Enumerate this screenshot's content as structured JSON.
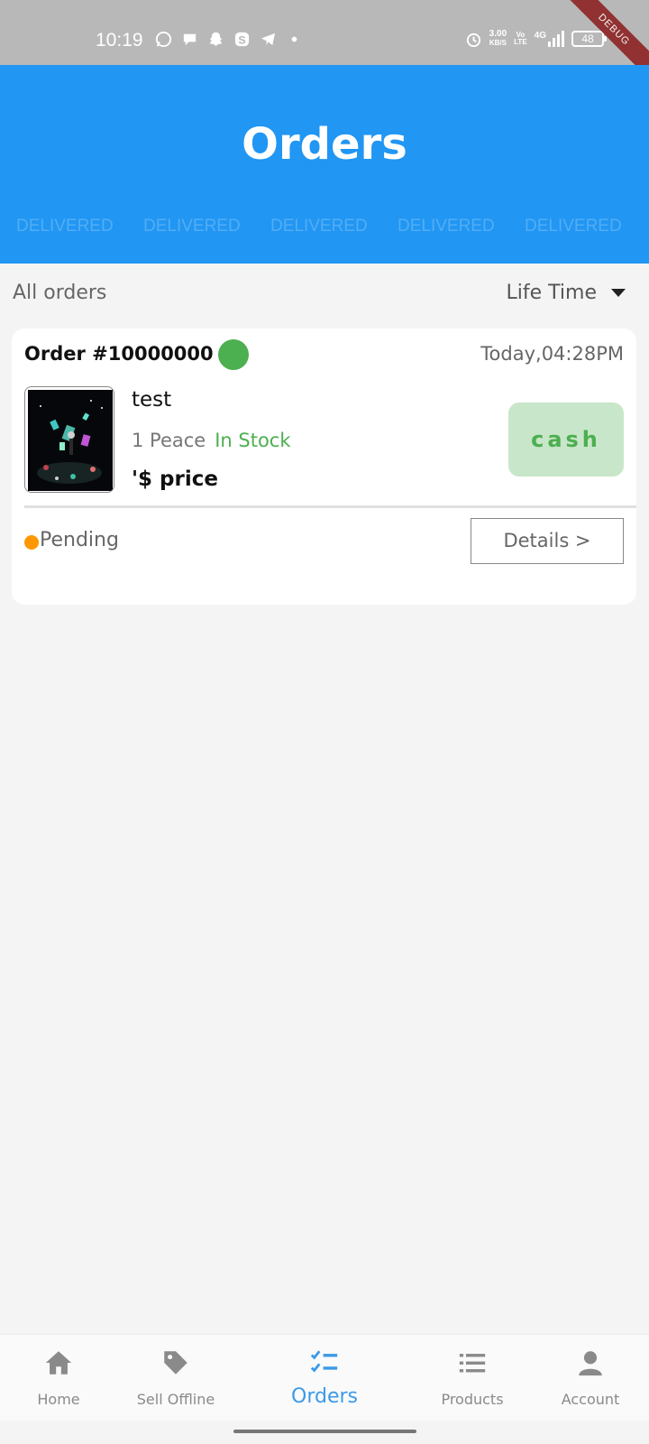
{
  "status_bar": {
    "time": "10:19",
    "speed_value": "3.00",
    "speed_unit": "KB/S",
    "volte_top": "Vo",
    "volte_bottom": "LTE",
    "network": "4G",
    "battery": "48",
    "debug_label": "DEBUG"
  },
  "header": {
    "title": "Orders",
    "tabs": [
      "DELIVERED",
      "DELIVERED",
      "DELIVERED",
      "DELIVERED",
      "DELIVERED"
    ]
  },
  "filter": {
    "all_orders_label": "All orders",
    "period_label": "Life Time"
  },
  "order": {
    "title": "Order #10000000",
    "date": "Today,04:28PM",
    "product_name": "test",
    "quantity": "1 Peace",
    "stock_status": "In Stock",
    "price": "'$ price",
    "payment_method": "cash",
    "status": "Pending",
    "details_label": "Details >"
  },
  "bottom_nav": {
    "items": [
      {
        "label": "Home",
        "icon": "home-icon"
      },
      {
        "label": "Sell Offline",
        "icon": "tag-icon"
      },
      {
        "label": "Orders",
        "icon": "checklist-icon"
      },
      {
        "label": "Products",
        "icon": "list-icon"
      },
      {
        "label": "Account",
        "icon": "person-icon"
      }
    ],
    "active": "Orders"
  },
  "colors": {
    "primary": "#2196f3",
    "in_stock": "#4caf50",
    "pending": "#ff9800",
    "cash_bg": "#c8e6c9",
    "nav_active": "#3b9ae8"
  }
}
